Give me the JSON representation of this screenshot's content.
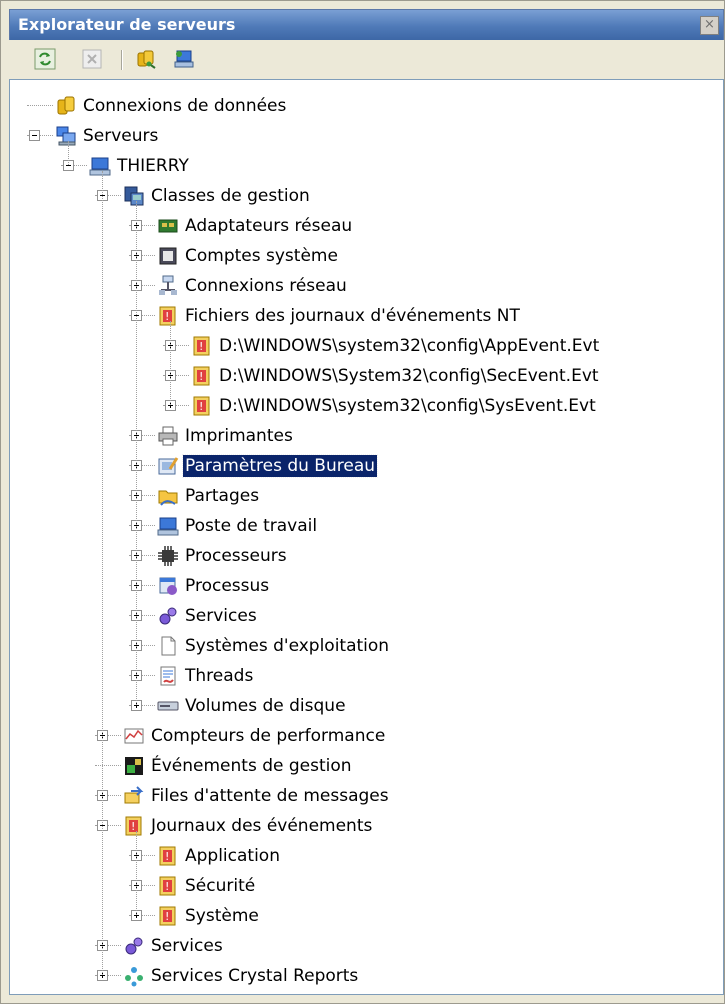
{
  "window": {
    "title": "Explorateur de serveurs",
    "close_glyph": "×"
  },
  "toolbar": {
    "buttons": [
      {
        "name": "refresh-button",
        "icon": "refresh-icon"
      },
      {
        "name": "stop-refresh-button",
        "icon": "stop-icon"
      },
      {
        "name": "connect-database-button",
        "icon": "connect-database-icon"
      },
      {
        "name": "connect-server-button",
        "icon": "connect-server-icon"
      }
    ]
  },
  "tree": [
    {
      "label": "Connexions de données",
      "icon": "database-icon",
      "expander": "none"
    },
    {
      "label": "Serveurs",
      "icon": "servers-icon",
      "expander": "minus"
    },
    {
      "label": "THIERRY",
      "icon": "computer-icon",
      "expander": "minus"
    },
    {
      "label": "Classes de gestion",
      "icon": "management-classes-icon",
      "expander": "minus"
    },
    {
      "label": "Adaptateurs réseau",
      "icon": "network-card-icon",
      "expander": "plus"
    },
    {
      "label": "Comptes système",
      "icon": "system-account-icon",
      "expander": "plus"
    },
    {
      "label": "Connexions réseau",
      "icon": "network-connection-icon",
      "expander": "plus"
    },
    {
      "label": "Fichiers des journaux d'événements NT",
      "icon": "event-log-icon",
      "expander": "minus"
    },
    {
      "label": "D:\\WINDOWS\\system32\\config\\AppEvent.Evt",
      "icon": "event-log-icon",
      "expander": "plus"
    },
    {
      "label": "D:\\WINDOWS\\System32\\config\\SecEvent.Evt",
      "icon": "event-log-icon",
      "expander": "plus"
    },
    {
      "label": "D:\\WINDOWS\\system32\\config\\SysEvent.Evt",
      "icon": "event-log-icon",
      "expander": "plus"
    },
    {
      "label": "Imprimantes",
      "icon": "printer-icon",
      "expander": "plus"
    },
    {
      "label": "Paramètres du Bureau",
      "icon": "desktop-settings-icon",
      "expander": "plus",
      "selected": true
    },
    {
      "label": "Partages",
      "icon": "shared-folder-icon",
      "expander": "plus"
    },
    {
      "label": "Poste de travail",
      "icon": "computer-icon",
      "expander": "plus"
    },
    {
      "label": "Processeurs",
      "icon": "processor-icon",
      "expander": "plus"
    },
    {
      "label": "Processus",
      "icon": "process-icon",
      "expander": "plus"
    },
    {
      "label": "Services",
      "icon": "services-icon",
      "expander": "plus"
    },
    {
      "label": "Systèmes d'exploitation",
      "icon": "document-icon",
      "expander": "plus"
    },
    {
      "label": "Threads",
      "icon": "threads-icon",
      "expander": "plus"
    },
    {
      "label": "Volumes de disque",
      "icon": "disk-volume-icon",
      "expander": "plus"
    },
    {
      "label": "Compteurs de performance",
      "icon": "performance-counter-icon",
      "expander": "plus"
    },
    {
      "label": "Événements de gestion",
      "icon": "management-events-icon",
      "expander": "none"
    },
    {
      "label": "Files d'attente de messages",
      "icon": "message-queue-icon",
      "expander": "plus"
    },
    {
      "label": "Journaux des événements",
      "icon": "event-log-icon",
      "expander": "minus"
    },
    {
      "label": "Application",
      "icon": "event-log-icon",
      "expander": "plus"
    },
    {
      "label": "Sécurité",
      "icon": "event-log-icon",
      "expander": "plus"
    },
    {
      "label": "Système",
      "icon": "event-log-icon",
      "expander": "plus"
    },
    {
      "label": "Services",
      "icon": "services-icon",
      "expander": "plus"
    },
    {
      "label": "Services Crystal Reports",
      "icon": "crystal-reports-icon",
      "expander": "plus"
    }
  ],
  "colors": {
    "title_bar": "#4f7ab8",
    "selection": "#0a246a",
    "tree_bg": "#ffffff"
  }
}
